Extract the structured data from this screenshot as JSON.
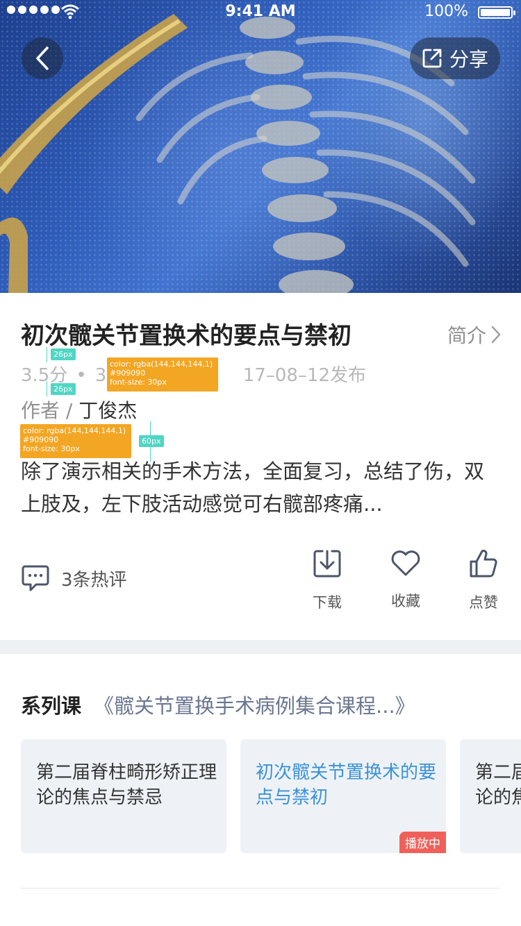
{
  "status_bar": {
    "time": "9:41 AM",
    "battery": "100%"
  },
  "header": {
    "share_label": "分享"
  },
  "course": {
    "title": "初次髋关节置换术的要点与禁初",
    "intro_link": "简介",
    "rating": "3.5分",
    "meta_hidden_count": "35",
    "publish_date": "17–08–12发布",
    "author_prefix": "作者 / ",
    "author_name": "丁俊杰",
    "description": "除了演示相关的手术方法，全面复习，总结了伤，双上肢及，左下肢活动感觉可右髋部疼痛..."
  },
  "annotations": {
    "spacing_a": "26px",
    "spacing_b": "26px",
    "spacing_c": "60px",
    "style_note_1": "color: rgba(144,144,144,1)\n#909090\nfont-size: 30px",
    "style_note_2": "color: rgba(144,144,144,1)\n#909090\nfont-size: 30px"
  },
  "actions": {
    "comments_label": "3条热评",
    "download_label": "下载",
    "favorite_label": "收藏",
    "like_label": "点赞"
  },
  "series": {
    "label": "系列课",
    "name": "《髋关节置换手术病例集合课程...》",
    "cards": [
      {
        "title": "第二届脊柱畸形矫正理论的焦点与禁忌"
      },
      {
        "title": "初次髋关节置换术的要点与禁初",
        "badge": "播放中"
      },
      {
        "title": "第二届脊柱畸形矫正理论的焦点与禁忌"
      }
    ]
  },
  "colors": {
    "accent": "#3a92d8",
    "badge": "#f0605a",
    "muted": "#909090",
    "annotation_teal": "#4fd6c4",
    "annotation_orange": "#f3a623"
  },
  "icons": [
    "back-icon",
    "share-icon",
    "chevron-right-icon",
    "comment-icon",
    "download-icon",
    "heart-icon",
    "thumbs-up-icon"
  ]
}
